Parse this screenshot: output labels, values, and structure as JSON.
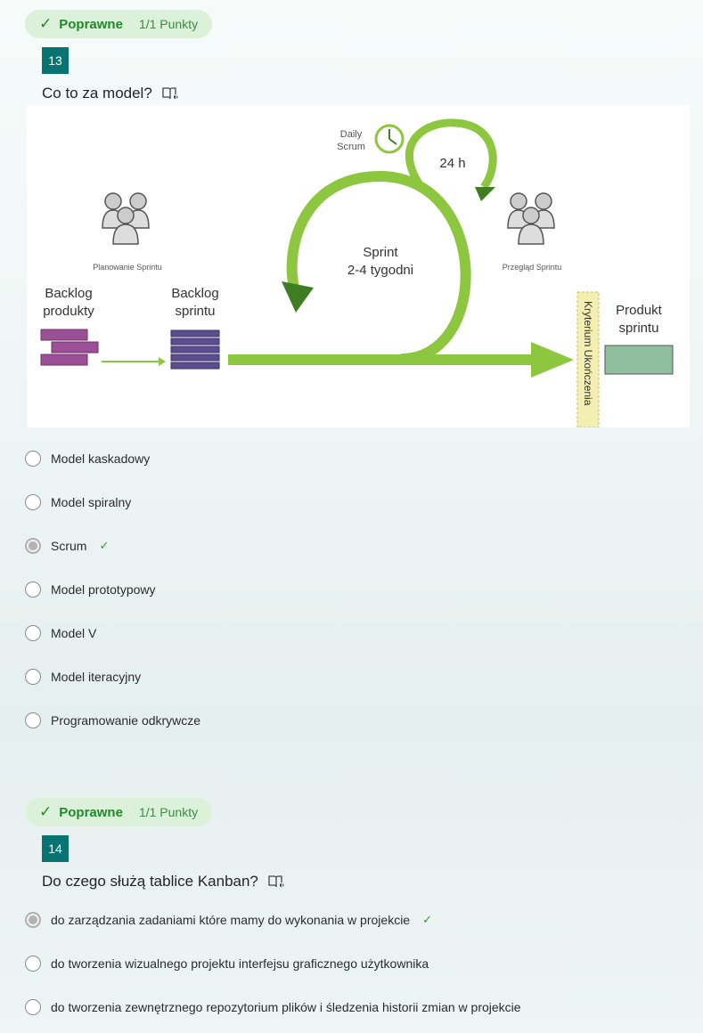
{
  "q13": {
    "status": "Poprawne",
    "points": "1/1 Punkty",
    "number": "13",
    "title": "Co to za model?",
    "diagram": {
      "daily_scrum_line1": "Daily",
      "daily_scrum_line2": "Scrum",
      "loop_24h": "24 h",
      "sprint_line1": "Sprint",
      "sprint_line2": "2-4 tygodni",
      "planning": "Planowanie Sprintu",
      "review": "Przegląd Sprintu",
      "backlog_product_line1": "Backlog",
      "backlog_product_line2": "produkty",
      "backlog_sprint_line1": "Backlog",
      "backlog_sprint_line2": "sprintu",
      "done_criteria": "Kryterium Ukończenia",
      "product_line1": "Produkt",
      "product_line2": "sprintu"
    },
    "options": [
      {
        "label": "Model kaskadowy",
        "selected": false,
        "correct": false
      },
      {
        "label": "Model spiralny",
        "selected": false,
        "correct": false
      },
      {
        "label": "Scrum",
        "selected": true,
        "correct": true
      },
      {
        "label": "Model prototypowy",
        "selected": false,
        "correct": false
      },
      {
        "label": "Model V",
        "selected": false,
        "correct": false
      },
      {
        "label": "Model iteracyjny",
        "selected": false,
        "correct": false
      },
      {
        "label": "Programowanie odkrywcze",
        "selected": false,
        "correct": false
      }
    ]
  },
  "q14": {
    "status": "Poprawne",
    "points": "1/1 Punkty",
    "number": "14",
    "title": "Do czego służą tablice Kanban?",
    "options": [
      {
        "label": "do zarządzania zadaniami które mamy do wykonania w projekcie",
        "selected": true,
        "correct": true
      },
      {
        "label": "do tworzenia wizualnego projektu interfejsu graficznego użytkownika",
        "selected": false,
        "correct": false
      },
      {
        "label": "do tworzenia zewnętrznego repozytorium plików i śledzenia historii zmian w projekcie",
        "selected": false,
        "correct": false
      }
    ]
  },
  "colors": {
    "accent_teal": "#077472",
    "correct_green": "#1f8a2c",
    "badge_bg": "#dcf1d9",
    "diagram_green": "#8dc63f",
    "backlog_product": "#9b4f96",
    "backlog_sprint": "#5b4d8f",
    "product_box": "#8fbf9f"
  },
  "icons": {
    "check": "✓",
    "reader": "immersive-reader-icon"
  }
}
